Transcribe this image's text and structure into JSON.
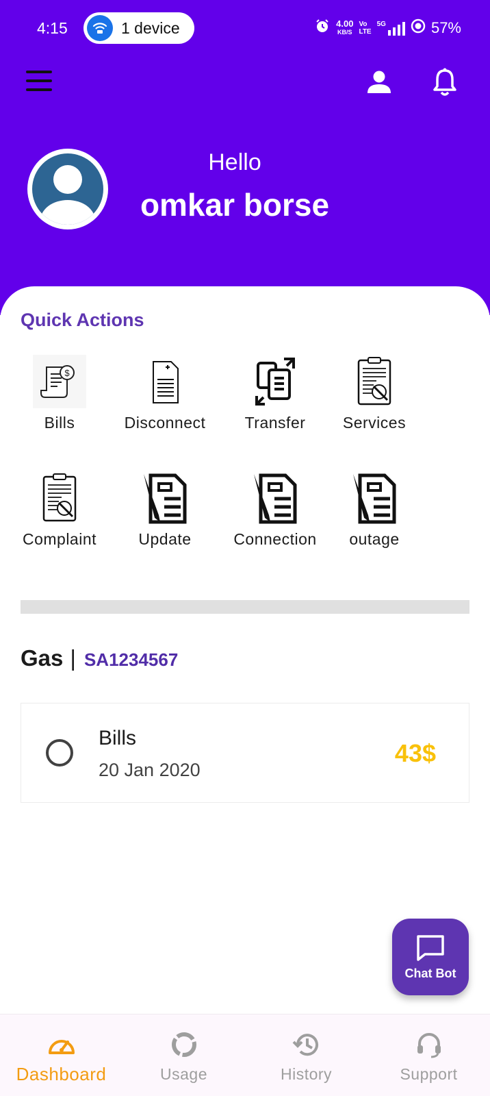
{
  "status_bar": {
    "time": "4:15",
    "device_pill": "1 device",
    "speed_value": "4.00",
    "speed_unit": "KB/S",
    "volte_top": "Vo",
    "volte_bottom": "LTE",
    "network": "5G",
    "battery": "57%"
  },
  "profile": {
    "greeting": "Hello",
    "name": "omkar borse"
  },
  "quick_actions": {
    "title": "Quick Actions",
    "items": [
      {
        "label": "Bills",
        "icon": "bill-receipt-icon"
      },
      {
        "label": "Disconnect",
        "icon": "document-plus-icon"
      },
      {
        "label": "Transfer",
        "icon": "transfer-document-icon"
      },
      {
        "label": "Services",
        "icon": "clipboard-wrench-icon"
      },
      {
        "label": "Complaint",
        "icon": "clipboard-wrench-icon"
      },
      {
        "label": "Update",
        "icon": "document-pen-icon"
      },
      {
        "label": "Connection",
        "icon": "document-pen-icon"
      },
      {
        "label": "outage",
        "icon": "document-pen-icon"
      }
    ]
  },
  "account": {
    "type": "Gas",
    "separator": "|",
    "number": "SA1234567"
  },
  "bill": {
    "name": "Bills",
    "date": "20 Jan 2020",
    "amount": "43$"
  },
  "fab": {
    "label": "Chat Bot"
  },
  "bottom_nav": {
    "items": [
      {
        "label": "Dashboard",
        "icon": "speedometer-icon",
        "active": true
      },
      {
        "label": "Usage",
        "icon": "donut-chart-icon",
        "active": false
      },
      {
        "label": "History",
        "icon": "history-icon",
        "active": false
      },
      {
        "label": "Support",
        "icon": "headset-icon",
        "active": false
      }
    ]
  },
  "colors": {
    "header": "#6200ea",
    "accent_purple": "#5e35b1",
    "amount_yellow": "#f9c10b",
    "nav_active": "#f39c12"
  }
}
